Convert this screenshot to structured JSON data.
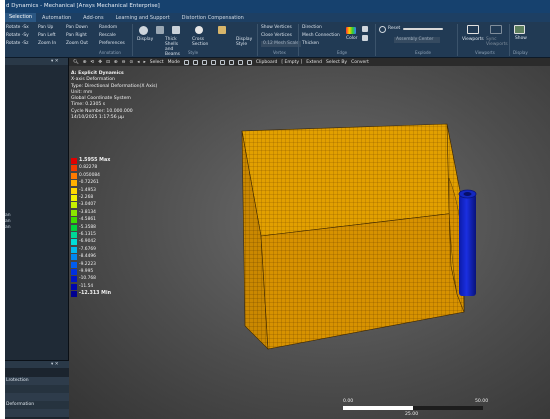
{
  "window": {
    "title": "d Dynamics - Mechanical [Ansys Mechanical Enterprise]"
  },
  "menu": {
    "items": [
      {
        "label": "Selection",
        "active": true
      },
      {
        "label": "Automation"
      },
      {
        "label": "Add-ons"
      },
      {
        "label": "Learning and Support"
      },
      {
        "label": "Distortion Compensation"
      }
    ]
  },
  "ribbon": {
    "tools": [
      {
        "label": "Rotate -Sx",
        "icon": "rotate-icon"
      },
      {
        "label": "Rotate -Sy",
        "icon": "rotate-icon"
      },
      {
        "label": "Rotate -Sz",
        "icon": "rotate-icon"
      },
      {
        "label": "Pan Up",
        "icon": "pan-icon"
      },
      {
        "label": "Pan Left",
        "icon": "pan-icon"
      },
      {
        "label": "Zoom In",
        "icon": "zoom-icon"
      },
      {
        "label": "Pan Down",
        "icon": "pan-icon"
      },
      {
        "label": "Pan Right",
        "icon": "pan-icon"
      },
      {
        "label": "Zoom Out",
        "icon": "zoom-icon"
      },
      {
        "label": "Random",
        "icon": "random-icon"
      },
      {
        "label": "Rescale",
        "icon": "rescale-icon"
      },
      {
        "label": "Preferences",
        "icon": "preferences-icon"
      }
    ],
    "display": {
      "label": "Display",
      "group": "Annotation"
    },
    "style": {
      "labels": [
        "Thick Shells and Beams",
        "Cross Section",
        "Assembly Center",
        "Display Style"
      ],
      "group": "Style"
    },
    "vertex": {
      "show": "Show Vertices",
      "close": "Close Vertices",
      "tolerance": "0.12 Mesh Scale",
      "group": "Vertex"
    },
    "edge": {
      "direction": "Direction",
      "mesh_connection": "Mesh Connection",
      "thicken": "Thicken",
      "color": "Color",
      "group": "Edge"
    },
    "explode": {
      "label": "Reset",
      "dropdown": "Assembly Center",
      "group": "Explode"
    },
    "viewports": {
      "label": "Viewports",
      "sublabel": "Sync Viewports",
      "group": "Viewports"
    },
    "show": {
      "label": "Show",
      "group": "Display"
    }
  },
  "graphics_toolbar": {
    "select": "Select",
    "mode": "Mode",
    "clipboard": "Clipboard",
    "empty": "[ Empty ]",
    "extend": "Extend",
    "select_by": "Select By",
    "convert": "Convert"
  },
  "result": {
    "system": "A: Explicit Dynamics",
    "name": "X-axis Deformation",
    "type": "Type: Directional Deformation(X Axis)",
    "unit": "Unit: mm",
    "coords": "Global Coordinate System",
    "time": "Time: 0.2305 s",
    "cycle": "Cycle Number: 10.000.000",
    "date": "14/10/2025 1:17:56 μμ"
  },
  "legend": {
    "items": [
      {
        "label": "1.5955 Max",
        "color": "#e00000"
      },
      {
        "label": "0.82278",
        "color": "#f23a00"
      },
      {
        "label": "0.050084",
        "color": "#ff7a00"
      },
      {
        "label": "-0.72261",
        "color": "#ffb000"
      },
      {
        "label": "-1.4953",
        "color": "#ffd800"
      },
      {
        "label": "-2.268",
        "color": "#f2f200"
      },
      {
        "label": "-3.0407",
        "color": "#c8f000"
      },
      {
        "label": "-3.8134",
        "color": "#8be800"
      },
      {
        "label": "-4.5861",
        "color": "#3ddc00"
      },
      {
        "label": "-5.3588",
        "color": "#00d23c"
      },
      {
        "label": "-6.1315",
        "color": "#00d898"
      },
      {
        "label": "-6.9042",
        "color": "#00dcd8"
      },
      {
        "label": "-7.6769",
        "color": "#00b8ee"
      },
      {
        "label": "-8.4496",
        "color": "#0088f2"
      },
      {
        "label": "-9.2223",
        "color": "#005cf0"
      },
      {
        "label": "-9.995",
        "color": "#0030e0"
      },
      {
        "label": "-10.768",
        "color": "#0014c8"
      },
      {
        "label": "-11.54",
        "color": "#0006b0"
      },
      {
        "label": "-12.313 Min",
        "color": "#000090"
      }
    ]
  },
  "scale_bar": {
    "left": "0.00",
    "mid": "25.00",
    "right": "50.00"
  },
  "left_panel": {
    "lines": [
      "an",
      "an",
      "an"
    ],
    "rows": [
      "Lrotection",
      "",
      "",
      "Deformation",
      ""
    ]
  },
  "colors": {
    "block_face": "#e2a000",
    "mesh_line": "#7a4c00",
    "cylinder": "#1020c8"
  }
}
